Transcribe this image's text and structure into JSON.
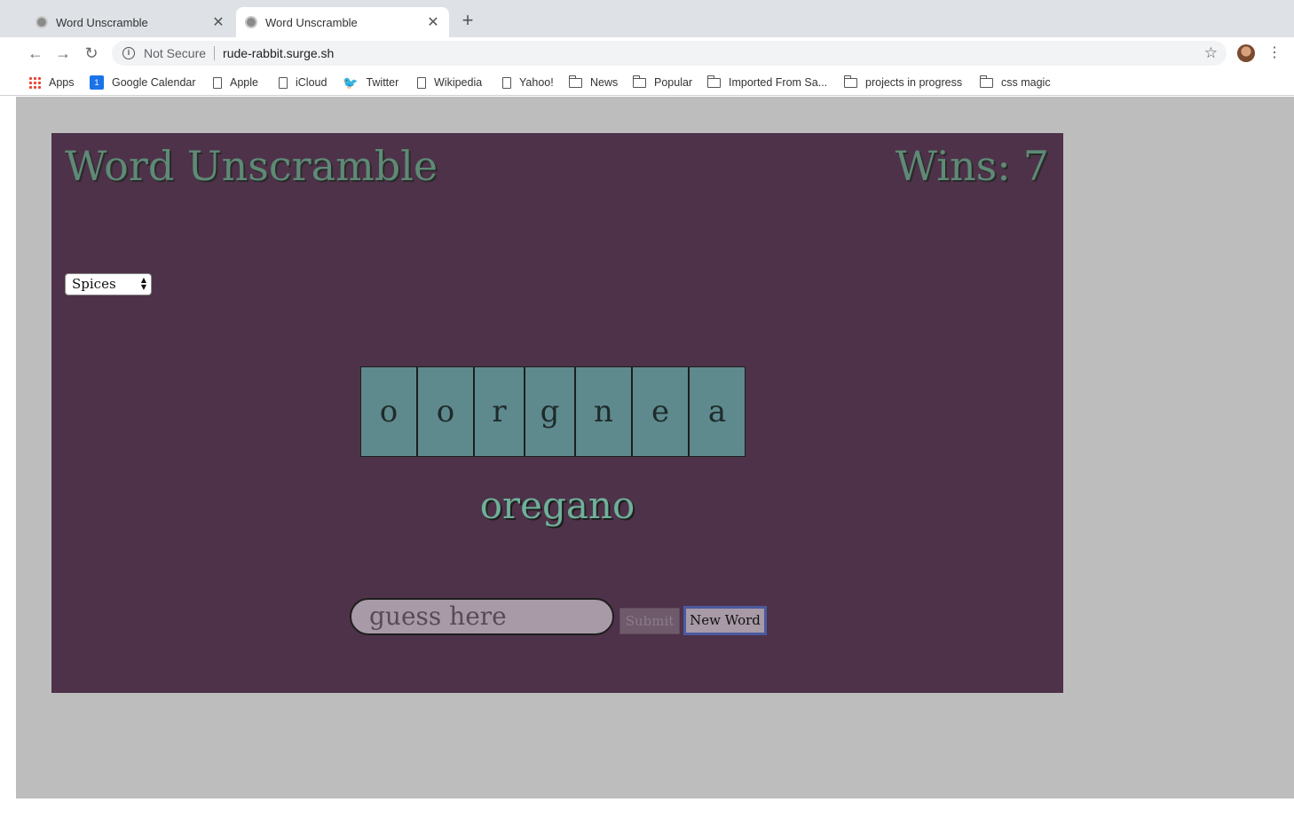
{
  "browser": {
    "tabs": [
      {
        "title": "Word Unscramble",
        "active": false
      },
      {
        "title": "Word Unscramble",
        "active": true
      }
    ],
    "security_label": "Not Secure",
    "url": "rude-rabbit.surge.sh",
    "bookmarks": [
      "Apps",
      "Google Calendar",
      "Apple",
      "iCloud",
      "Twitter",
      "Wikipedia",
      "Yahoo!",
      "News",
      "Popular",
      "Imported From Sa...",
      "projects in progress",
      "css magic"
    ]
  },
  "game": {
    "title": "Word Unscramble",
    "wins_label": "Wins:",
    "wins_count": "7",
    "category": "Spices",
    "tiles": [
      "o",
      "o",
      "r",
      "g",
      "n",
      "e",
      "a"
    ],
    "answer": "oregano",
    "guess_placeholder": "guess here",
    "submit_label": "Submit",
    "new_word_label": "New Word"
  },
  "colors": {
    "background": "#bdbdbd",
    "panel": "#4e3249",
    "title": "#5e8a76",
    "tile": "#5e8a8d",
    "answer": "#6fb09a"
  }
}
